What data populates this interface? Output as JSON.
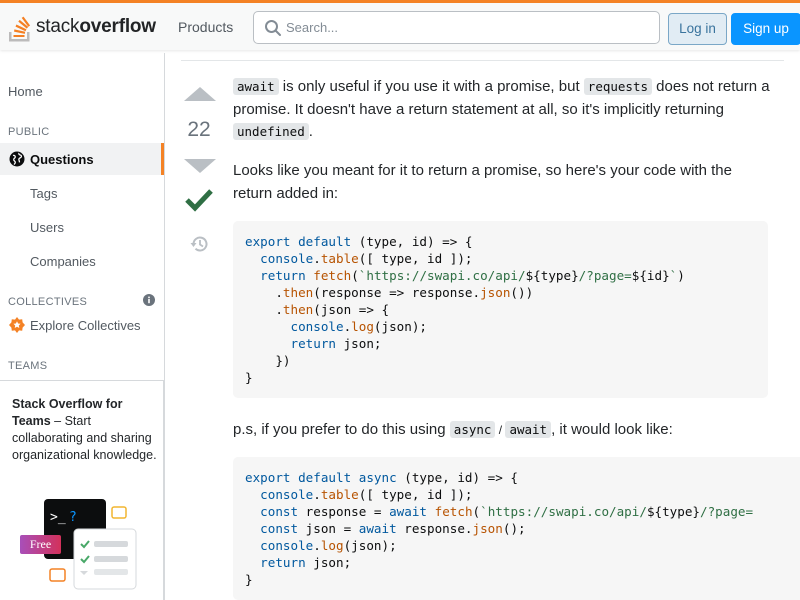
{
  "topbar": {
    "logo_light": "stack",
    "logo_bold": "overflow",
    "products": "Products",
    "search_placeholder": "Search...",
    "login": "Log in",
    "signup": "Sign up"
  },
  "sidebar": {
    "home": "Home",
    "public_label": "PUBLIC",
    "questions": "Questions",
    "tags": "Tags",
    "users": "Users",
    "companies": "Companies",
    "collectives_label": "COLLECTIVES",
    "explore_collectives": "Explore Collectives",
    "teams_label": "TEAMS",
    "teams_title": "Stack Overflow for Teams",
    "teams_dash": " – Start collaborating and sharing organizational knowledge.",
    "free_badge": "Free"
  },
  "answer": {
    "votes": "22",
    "p1": {
      "c1": "await",
      "t1": " is only useful if you use it with a promise, but ",
      "c2": "requests",
      "t2": " does not return a promise. It doesn't have a return statement at all, so it's implicitly returning ",
      "c3": "undefined",
      "t3": "."
    },
    "p2": "Looks like you meant for it to return a promise, so here's your code with the return added in:",
    "code1": [
      "export default (type, id) => {",
      "  console.table([ type, id ]);",
      "  return fetch(`https://swapi.co/api/${type}/?page=${id}`)",
      "    .then(response => response.json())",
      "    .then(json => {",
      "      console.log(json);",
      "      return json;",
      "    })",
      "}"
    ],
    "p3": {
      "t1": "p.s, if you prefer to do this using ",
      "c1": "async",
      "slash": " / ",
      "c2": "await",
      "t2": ", it would look like:"
    },
    "code2": [
      "export default async (type, id) => {",
      "  console.table([ type, id ]);",
      "  const response = await fetch(`https://swapi.co/api/${type}/?page=",
      "  const json = await response.json();",
      "  console.log(json);",
      "  return json;",
      "}"
    ]
  },
  "colors": {
    "accent": "#f48225",
    "link_blue": "#0a95ff",
    "accepted_green": "#2f6f44"
  },
  "icons": [
    "search-icon",
    "globe-icon",
    "info-icon",
    "collectives-icon",
    "vote-up-icon",
    "vote-down-icon",
    "accepted-check-icon",
    "history-icon"
  ]
}
